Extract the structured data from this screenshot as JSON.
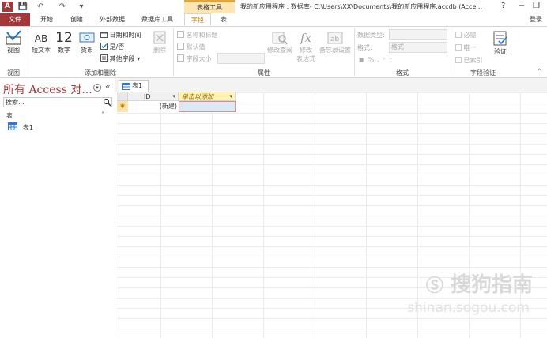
{
  "window": {
    "title": "我的新应用程序 : 数据库- C:\\Users\\XX\\Documents\\我的新应用程序.accdb (Acce...",
    "context_tab_group": "表格工具",
    "login": "登录",
    "help": "?",
    "minimize": "−",
    "restore": "❐"
  },
  "qat": {
    "logo": "A",
    "save": "💾",
    "undo": "↶",
    "redo": "↷",
    "more": "▾"
  },
  "tabs": [
    "文件",
    "开始",
    "创建",
    "外部数据",
    "数据库工具",
    "字段",
    "表"
  ],
  "ribbon": {
    "views": {
      "label": "视图",
      "group": "视图"
    },
    "add_delete": {
      "short_text": "短文本",
      "short_text_icon_text": "AB",
      "number": "数字",
      "number_icon_text": "12",
      "currency": "货币",
      "date_time": "日期和时间",
      "yes_no": "是/否",
      "more_fields": "其他字段",
      "delete": "删除",
      "group": "添加和删除"
    },
    "properties": {
      "name_caption": "名称和标题",
      "default_value": "默认值",
      "field_size": "字段大小",
      "modify_lookups": "修改查阅",
      "modify_expression_line1": "修改",
      "modify_expression_line2": "表达式",
      "memo_settings": "备忘录设置",
      "group": "属性"
    },
    "formatting": {
      "data_type": "数据类型:",
      "format": "格式:",
      "format_value": "格式",
      "group": "格式"
    },
    "validation": {
      "required": "必需",
      "unique": "唯一",
      "indexed": "已索引",
      "validation": "验证",
      "group": "字段验证"
    }
  },
  "nav": {
    "title": "所有 Access 对...",
    "search_placeholder": "搜索...",
    "section": "表",
    "items": [
      "表1"
    ]
  },
  "document": {
    "tab": "表1",
    "columns": [
      "ID",
      "单击以添加"
    ],
    "new_row_marker": "✱",
    "new_row_value": "(新建)"
  },
  "watermark": {
    "text": "搜狗指南",
    "url": "shinan.sogou.com"
  },
  "colors": {
    "accent": "#a4373a",
    "context": "#fde6b4",
    "field_tab": "#c47b00",
    "header_add": "#fff2b3"
  }
}
